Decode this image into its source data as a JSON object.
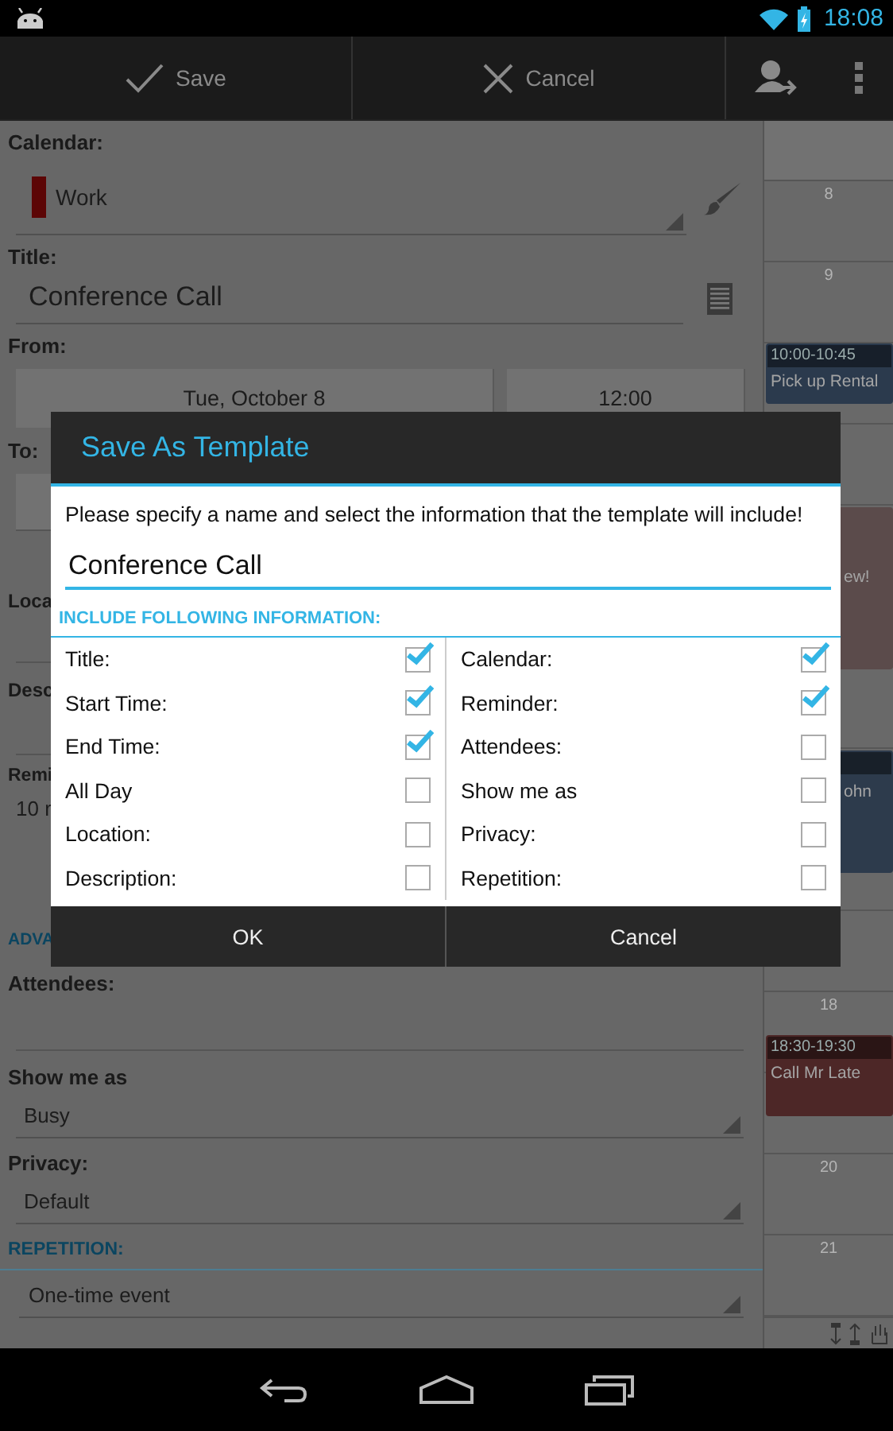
{
  "status_bar": {
    "time": "18:08"
  },
  "action_bar": {
    "buttons": [
      {
        "label": "Save"
      },
      {
        "label": "Cancel"
      }
    ]
  },
  "form": {
    "calendar_label": "Calendar:",
    "calendar": {
      "value": "Work",
      "color": "#5c0606"
    },
    "title_label": "Title:",
    "title": "Conference Call",
    "from_label": "From:",
    "from_date": "Tue, October 8",
    "from_time": "12:00",
    "to_label": "To:",
    "location_label": "Loca",
    "description_label": "Desc",
    "reminder_label": "Remi",
    "reminder_value": "10 r",
    "advanced_header": "ADVA",
    "attendees_label": "Attendees:",
    "show_me_as_label": "Show me as",
    "show_me_as": "Busy",
    "privacy_label": "Privacy:",
    "privacy": "Default",
    "repetition_header": "REPETITION:",
    "repetition": "One-time event"
  },
  "day_view": {
    "hour_labels": [
      "8",
      "9",
      "18",
      "20",
      "21"
    ],
    "events": [
      {
        "time": "10:00-10:45",
        "title": "Pick up Rental",
        "color": "#2b3a4d"
      },
      {
        "title": "ew!",
        "color": "#5b4b4b"
      },
      {
        "title": "ohn",
        "color": "#2d3b4c"
      },
      {
        "time": "18:30-19:30",
        "title": "Call Mr Late",
        "color": "#4d2727"
      }
    ]
  },
  "dialog": {
    "title": "Save As Template",
    "prompt": "Please specify a name and select the information that the template will include!",
    "name": "Conference Call",
    "section": "INCLUDE FOLLOWING INFORMATION:",
    "columns": [
      [
        {
          "label": "Title:",
          "checked": true
        },
        {
          "label": "Start Time:",
          "checked": true
        },
        {
          "label": "End Time:",
          "checked": true
        },
        {
          "label": "All Day",
          "checked": false
        },
        {
          "label": "Location:",
          "checked": false
        },
        {
          "label": "Description:",
          "checked": false
        }
      ],
      [
        {
          "label": "Calendar:",
          "checked": true
        },
        {
          "label": "Reminder:",
          "checked": true
        },
        {
          "label": "Attendees:",
          "checked": false
        },
        {
          "label": "Show me as",
          "checked": false
        },
        {
          "label": "Privacy:",
          "checked": false
        },
        {
          "label": "Repetition:",
          "checked": false
        }
      ]
    ],
    "buttons": [
      "OK",
      "Cancel"
    ]
  }
}
